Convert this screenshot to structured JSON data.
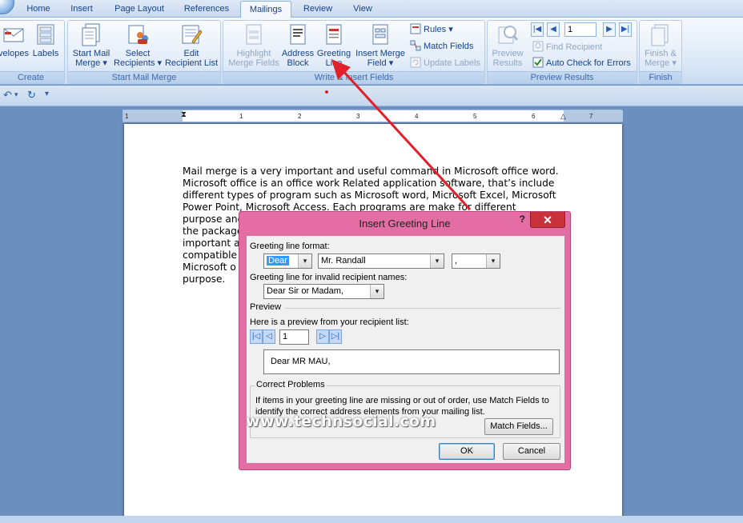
{
  "tabs": [
    {
      "label": "Home"
    },
    {
      "label": "Insert"
    },
    {
      "label": "Page Layout"
    },
    {
      "label": "References"
    },
    {
      "label": "Mailings"
    },
    {
      "label": "Review"
    },
    {
      "label": "View"
    }
  ],
  "ribbon": {
    "create": {
      "label": "Create",
      "envelopes": "velopes",
      "labels": "Labels"
    },
    "start": {
      "label": "Start Mail Merge",
      "start_mail_merge_1": "Start Mail",
      "start_mail_merge_2": "Merge",
      "select_recipients_1": "Select",
      "select_recipients_2": "Recipients",
      "edit_list_1": "Edit",
      "edit_list_2": "Recipient List"
    },
    "write": {
      "label": "Write & Insert Fields",
      "highlight_1": "Highlight",
      "highlight_2": "Merge Fields",
      "address_1": "Address",
      "address_2": "Block",
      "greeting_1": "Greeting",
      "greeting_2": "Line",
      "insert_field_1": "Insert Merge",
      "insert_field_2": "Field",
      "rules": "Rules",
      "match_fields": "Match Fields",
      "update_labels": "Update Labels"
    },
    "preview": {
      "label": "Preview Results",
      "preview_1": "Preview",
      "preview_2": "Results",
      "record": "1",
      "find_recipient": "Find Recipient",
      "auto_check": "Auto Check for Errors"
    },
    "finish": {
      "label": "Finish",
      "finish_1": "Finish &",
      "finish_2": "Merge"
    }
  },
  "ruler": {
    "ticks": [
      "1",
      "1",
      "2",
      "3",
      "4",
      "5",
      "6",
      "7"
    ]
  },
  "document": {
    "lines": [
      "Mail merge is a very important and useful command in Microsoft office word.",
      "Microsoft office is an office work Related application software, that’s include",
      "different types of program such as Microsoft word, Microsoft Excel, Microsoft",
      "Power Point,  Microsoft Access. Each programs are make for different",
      "purpose and",
      "the package",
      "important a",
      "compatible",
      "Microsoft o",
      "purpose."
    ]
  },
  "dialog": {
    "title": "Insert Greeting Line",
    "help": "?",
    "close": "✕",
    "format_label": "Greeting line format:",
    "salutation": "Dear",
    "name_format": "Mr. Randall",
    "punctuation": ",",
    "invalid_label": "Greeting line for invalid recipient names:",
    "invalid_value": "Dear Sir or Madam,",
    "preview_section": "Preview",
    "preview_label": "Here is a preview from your recipient list:",
    "record": "1",
    "preview_text": "Dear MR MAU,",
    "correct_title": "Correct Problems",
    "correct_text_1": "If items in your greeting line are missing or out of order, use Match Fields to",
    "correct_text_2": "identify the correct address elements from your mailing list.",
    "match_fields": "Match Fields...",
    "ok": "OK",
    "cancel": "Cancel",
    "watermark": "www.technsocial.com"
  },
  "colors": {
    "ribbon_text": "#15428b",
    "dialog_frame": "#e46ea3",
    "close_button": "#c9313b",
    "arrow": "#e0202a"
  }
}
